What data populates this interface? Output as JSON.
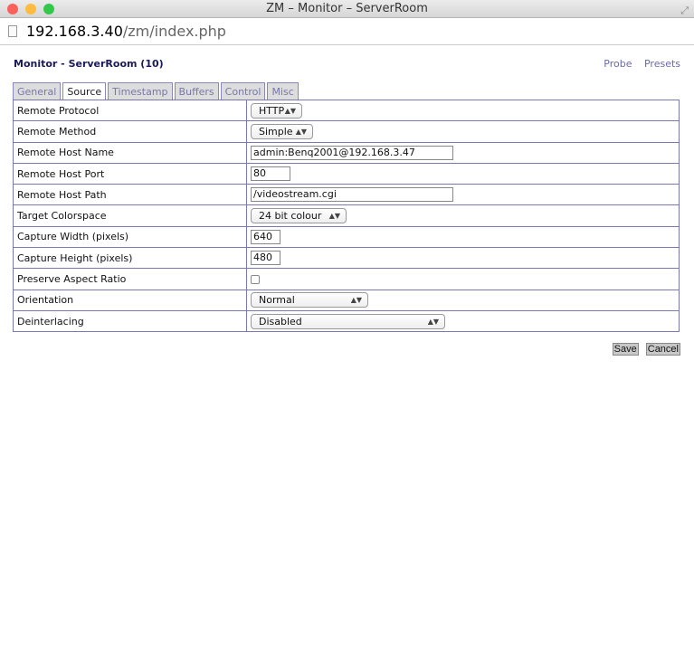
{
  "window": {
    "title": "ZM – Monitor – ServerRoom",
    "colors": {
      "close": "#fc605b",
      "minimize": "#fdbc40",
      "zoom": "#34c84a"
    }
  },
  "address": {
    "host": "192.168.3.40",
    "path": "/zm/index.php"
  },
  "page": {
    "heading": "Monitor - ServerRoom (10)",
    "links": [
      "Probe",
      "Presets"
    ]
  },
  "tabs": [
    {
      "label": "General"
    },
    {
      "label": "Source",
      "active": true
    },
    {
      "label": "Timestamp"
    },
    {
      "label": "Buffers"
    },
    {
      "label": "Control"
    },
    {
      "label": "Misc"
    }
  ],
  "fields": [
    {
      "label": "Remote Protocol",
      "type": "select",
      "value": "HTTP"
    },
    {
      "label": "Remote Method",
      "type": "select",
      "value": "Simple"
    },
    {
      "label": "Remote Host Name",
      "type": "text",
      "value": "admin:Benq2001@192.168.3.47"
    },
    {
      "label": "Remote Host Port",
      "type": "text",
      "value": "80"
    },
    {
      "label": "Remote Host Path",
      "type": "text",
      "value": "/videostream.cgi"
    },
    {
      "label": "Target Colorspace",
      "type": "select",
      "value": "24 bit colour"
    },
    {
      "label": "Capture Width (pixels)",
      "type": "text",
      "value": "640"
    },
    {
      "label": "Capture Height (pixels)",
      "type": "text",
      "value": "480"
    },
    {
      "label": "Preserve Aspect Ratio",
      "type": "checkbox",
      "checked": false
    },
    {
      "label": "Orientation",
      "type": "select",
      "value": "Normal"
    },
    {
      "label": "Deinterlacing",
      "type": "select",
      "value": "Disabled"
    }
  ],
  "buttons": {
    "save": "Save",
    "cancel": "Cancel"
  }
}
